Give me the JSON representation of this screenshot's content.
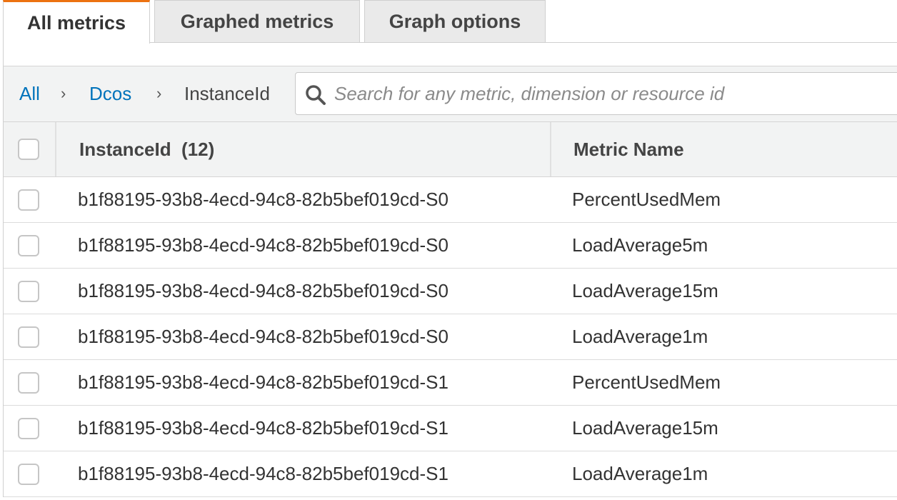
{
  "tabs": [
    {
      "label": "All metrics",
      "active": true
    },
    {
      "label": "Graphed metrics",
      "active": false
    },
    {
      "label": "Graph options",
      "active": false
    }
  ],
  "breadcrumb": {
    "items": [
      "All",
      "Dcos",
      "InstanceId"
    ],
    "separator": "›"
  },
  "search": {
    "placeholder": "Search for any metric, dimension or resource id",
    "value": ""
  },
  "table": {
    "columns": [
      "InstanceId  (12)",
      "Metric Name"
    ],
    "rows": [
      {
        "instance_id": "b1f88195-93b8-4ecd-94c8-82b5bef019cd-S0",
        "metric_name": "PercentUsedMem"
      },
      {
        "instance_id": "b1f88195-93b8-4ecd-94c8-82b5bef019cd-S0",
        "metric_name": "LoadAverage5m"
      },
      {
        "instance_id": "b1f88195-93b8-4ecd-94c8-82b5bef019cd-S0",
        "metric_name": "LoadAverage15m"
      },
      {
        "instance_id": "b1f88195-93b8-4ecd-94c8-82b5bef019cd-S0",
        "metric_name": "LoadAverage1m"
      },
      {
        "instance_id": "b1f88195-93b8-4ecd-94c8-82b5bef019cd-S1",
        "metric_name": "PercentUsedMem"
      },
      {
        "instance_id": "b1f88195-93b8-4ecd-94c8-82b5bef019cd-S1",
        "metric_name": "LoadAverage15m"
      },
      {
        "instance_id": "b1f88195-93b8-4ecd-94c8-82b5bef019cd-S1",
        "metric_name": "LoadAverage1m"
      }
    ]
  },
  "colors": {
    "active_tab_accent": "#ec7211",
    "link": "#0073bb",
    "toolbar_bg": "#f2f3f3"
  }
}
